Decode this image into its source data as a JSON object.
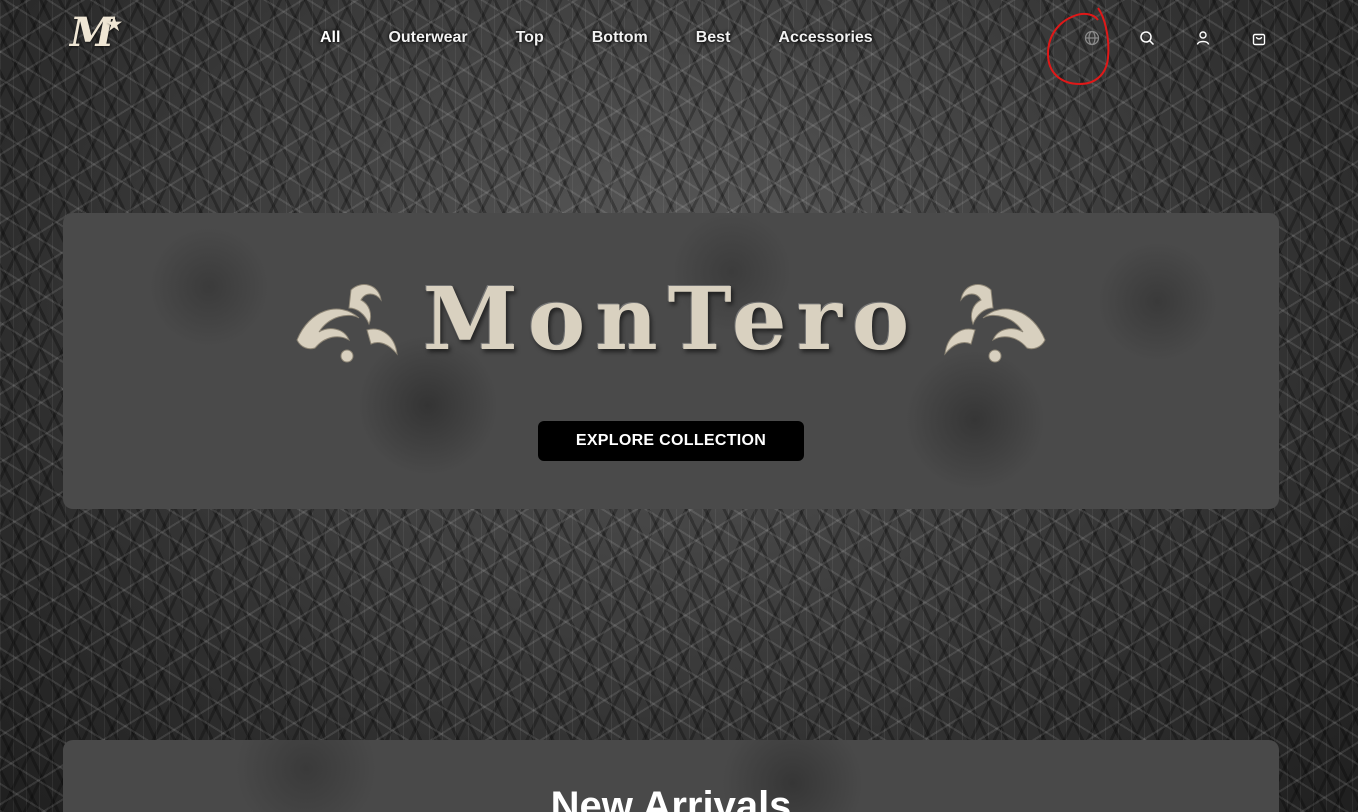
{
  "header": {
    "nav": [
      "All",
      "Outerwear",
      "Top",
      "Bottom",
      "Best",
      "Accessories"
    ],
    "icons": [
      "globe-icon",
      "search-icon",
      "user-icon",
      "shopping-bag-icon"
    ],
    "annotation_color": "#e01818"
  },
  "hero": {
    "brand": "MonTero",
    "cta_label": "EXPLORE COLLECTION"
  },
  "arrivals": {
    "title": "New Arrivals"
  }
}
